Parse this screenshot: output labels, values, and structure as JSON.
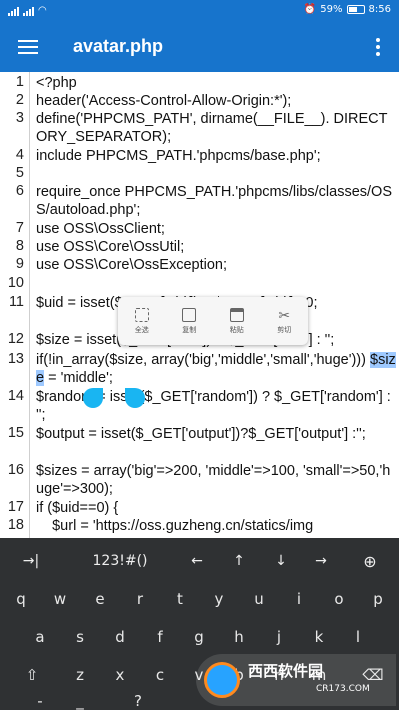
{
  "status_bar": {
    "battery": "59%",
    "time": "8:56"
  },
  "toolbar": {
    "title": "avatar.php"
  },
  "editor": {
    "lines": [
      {
        "n": "1",
        "text": "<?php"
      },
      {
        "n": "2",
        "text": "header('Access-Control-Allow-Origin:*');"
      },
      {
        "n": "3",
        "text": "define('PHPCMS_PATH', dirname(__FILE__). DIRECTORY_SEPARATOR);"
      },
      {
        "n": "4",
        "text": "include PHPCMS_PATH.'phpcms/base.php';"
      },
      {
        "n": "5",
        "text": ""
      },
      {
        "n": "6",
        "text": "require_once PHPCMS_PATH.'phpcms/libs/classes/OSS/autoload.php';"
      },
      {
        "n": "7",
        "text": "use OSS\\OssClient;"
      },
      {
        "n": "8",
        "text": "use OSS\\Core\\OssUtil;"
      },
      {
        "n": "9",
        "text": "use OSS\\Core\\OssException;"
      },
      {
        "n": "10",
        "text": ""
      },
      {
        "n": "11",
        "text": "$uid = isset($_GET['uid']) ? $_GET['uid'] : 0;"
      },
      {
        "n": "12",
        "text": "$size = isset($_GET['size']) ? $_GET['size'] : '';"
      },
      {
        "n": "13",
        "text": "if(!in_array($size, array('big','middle','small','huge'))) $size = 'middle';"
      },
      {
        "n": "14",
        "text": "$random = isset($_GET['random']) ? $_GET['random'] : '';"
      },
      {
        "n": "15",
        "text": "$output = isset($_GET['output'])?$_GET['output'] :'';"
      },
      {
        "n": "16",
        "text": "$sizes = array('big'=>200, 'middle'=>100, 'small'=>50,'huge'=>300);"
      },
      {
        "n": "17",
        "text": "if ($uid==0) {"
      },
      {
        "n": "18",
        "text": "    $url = 'https://oss.guzheng.cn/statics/img"
      }
    ],
    "selected_text": "$size"
  },
  "context_menu": {
    "items": [
      {
        "label": "全选",
        "icon": "select-all-icon"
      },
      {
        "label": "复制",
        "icon": "copy-icon"
      },
      {
        "label": "粘贴",
        "icon": "paste-icon"
      },
      {
        "label": "剪切",
        "icon": "cut-icon"
      }
    ]
  },
  "keyboard": {
    "top_row": [
      "→|",
      "123!#()",
      "←",
      "↑",
      "↓",
      "→",
      "globe"
    ],
    "row1": [
      "q",
      "w",
      "e",
      "r",
      "t",
      "y",
      "u",
      "i",
      "o",
      "p"
    ],
    "row2": [
      "a",
      "s",
      "d",
      "f",
      "g",
      "h",
      "j",
      "k",
      "l"
    ],
    "row3": [
      "⇧",
      "z",
      "x",
      "c",
      "v",
      "b",
      "n",
      "m",
      "⌫"
    ],
    "row4": [
      "-",
      "_",
      "?"
    ]
  },
  "watermark": {
    "brand": "西西软件园",
    "domain": "CR173.COM"
  }
}
